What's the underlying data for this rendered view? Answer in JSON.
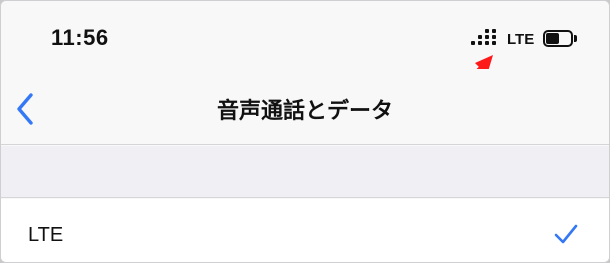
{
  "status_bar": {
    "time": "11:56",
    "network": "LTE",
    "signal_icon": "cellular-signal-icon",
    "battery_icon": "battery-icon",
    "battery_level": 0.55
  },
  "nav_bar": {
    "back_icon": "chevron-left-icon",
    "title": "音声通話とデータ"
  },
  "list": {
    "rows": [
      {
        "label": "LTE",
        "selected": true,
        "selected_icon": "checkmark-icon"
      }
    ]
  },
  "annotation": {
    "icon": "red-arrow-icon",
    "color": "#ff1a1a"
  },
  "colors": {
    "accent": "#3478f6",
    "annotation": "#ff1a1a"
  }
}
